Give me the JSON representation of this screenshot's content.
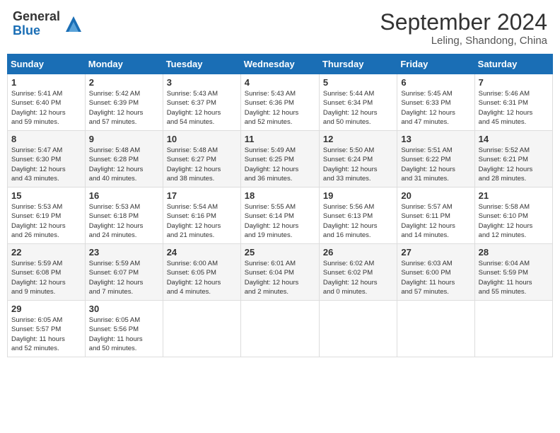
{
  "header": {
    "logo_general": "General",
    "logo_blue": "Blue",
    "month_year": "September 2024",
    "location": "Leling, Shandong, China"
  },
  "weekdays": [
    "Sunday",
    "Monday",
    "Tuesday",
    "Wednesday",
    "Thursday",
    "Friday",
    "Saturday"
  ],
  "weeks": [
    [
      {
        "day": "1",
        "sunrise": "5:41 AM",
        "sunset": "6:40 PM",
        "daylight": "12 hours and 59 minutes."
      },
      {
        "day": "2",
        "sunrise": "5:42 AM",
        "sunset": "6:39 PM",
        "daylight": "12 hours and 57 minutes."
      },
      {
        "day": "3",
        "sunrise": "5:43 AM",
        "sunset": "6:37 PM",
        "daylight": "12 hours and 54 minutes."
      },
      {
        "day": "4",
        "sunrise": "5:43 AM",
        "sunset": "6:36 PM",
        "daylight": "12 hours and 52 minutes."
      },
      {
        "day": "5",
        "sunrise": "5:44 AM",
        "sunset": "6:34 PM",
        "daylight": "12 hours and 50 minutes."
      },
      {
        "day": "6",
        "sunrise": "5:45 AM",
        "sunset": "6:33 PM",
        "daylight": "12 hours and 47 minutes."
      },
      {
        "day": "7",
        "sunrise": "5:46 AM",
        "sunset": "6:31 PM",
        "daylight": "12 hours and 45 minutes."
      }
    ],
    [
      {
        "day": "8",
        "sunrise": "5:47 AM",
        "sunset": "6:30 PM",
        "daylight": "12 hours and 43 minutes."
      },
      {
        "day": "9",
        "sunrise": "5:48 AM",
        "sunset": "6:28 PM",
        "daylight": "12 hours and 40 minutes."
      },
      {
        "day": "10",
        "sunrise": "5:48 AM",
        "sunset": "6:27 PM",
        "daylight": "12 hours and 38 minutes."
      },
      {
        "day": "11",
        "sunrise": "5:49 AM",
        "sunset": "6:25 PM",
        "daylight": "12 hours and 36 minutes."
      },
      {
        "day": "12",
        "sunrise": "5:50 AM",
        "sunset": "6:24 PM",
        "daylight": "12 hours and 33 minutes."
      },
      {
        "day": "13",
        "sunrise": "5:51 AM",
        "sunset": "6:22 PM",
        "daylight": "12 hours and 31 minutes."
      },
      {
        "day": "14",
        "sunrise": "5:52 AM",
        "sunset": "6:21 PM",
        "daylight": "12 hours and 28 minutes."
      }
    ],
    [
      {
        "day": "15",
        "sunrise": "5:53 AM",
        "sunset": "6:19 PM",
        "daylight": "12 hours and 26 minutes."
      },
      {
        "day": "16",
        "sunrise": "5:53 AM",
        "sunset": "6:18 PM",
        "daylight": "12 hours and 24 minutes."
      },
      {
        "day": "17",
        "sunrise": "5:54 AM",
        "sunset": "6:16 PM",
        "daylight": "12 hours and 21 minutes."
      },
      {
        "day": "18",
        "sunrise": "5:55 AM",
        "sunset": "6:14 PM",
        "daylight": "12 hours and 19 minutes."
      },
      {
        "day": "19",
        "sunrise": "5:56 AM",
        "sunset": "6:13 PM",
        "daylight": "12 hours and 16 minutes."
      },
      {
        "day": "20",
        "sunrise": "5:57 AM",
        "sunset": "6:11 PM",
        "daylight": "12 hours and 14 minutes."
      },
      {
        "day": "21",
        "sunrise": "5:58 AM",
        "sunset": "6:10 PM",
        "daylight": "12 hours and 12 minutes."
      }
    ],
    [
      {
        "day": "22",
        "sunrise": "5:59 AM",
        "sunset": "6:08 PM",
        "daylight": "12 hours and 9 minutes."
      },
      {
        "day": "23",
        "sunrise": "5:59 AM",
        "sunset": "6:07 PM",
        "daylight": "12 hours and 7 minutes."
      },
      {
        "day": "24",
        "sunrise": "6:00 AM",
        "sunset": "6:05 PM",
        "daylight": "12 hours and 4 minutes."
      },
      {
        "day": "25",
        "sunrise": "6:01 AM",
        "sunset": "6:04 PM",
        "daylight": "12 hours and 2 minutes."
      },
      {
        "day": "26",
        "sunrise": "6:02 AM",
        "sunset": "6:02 PM",
        "daylight": "12 hours and 0 minutes."
      },
      {
        "day": "27",
        "sunrise": "6:03 AM",
        "sunset": "6:00 PM",
        "daylight": "11 hours and 57 minutes."
      },
      {
        "day": "28",
        "sunrise": "6:04 AM",
        "sunset": "5:59 PM",
        "daylight": "11 hours and 55 minutes."
      }
    ],
    [
      {
        "day": "29",
        "sunrise": "6:05 AM",
        "sunset": "5:57 PM",
        "daylight": "11 hours and 52 minutes."
      },
      {
        "day": "30",
        "sunrise": "6:05 AM",
        "sunset": "5:56 PM",
        "daylight": "11 hours and 50 minutes."
      },
      null,
      null,
      null,
      null,
      null
    ]
  ]
}
